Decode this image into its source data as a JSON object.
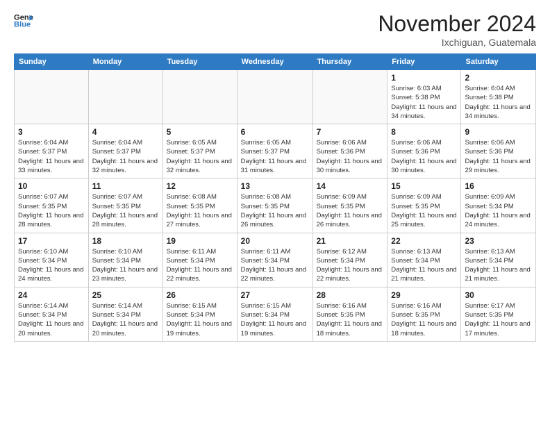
{
  "header": {
    "logo_line1": "General",
    "logo_line2": "Blue",
    "month_title": "November 2024",
    "location": "Ixchiguan, Guatemala"
  },
  "weekdays": [
    "Sunday",
    "Monday",
    "Tuesday",
    "Wednesday",
    "Thursday",
    "Friday",
    "Saturday"
  ],
  "weeks": [
    [
      {
        "day": "",
        "info": ""
      },
      {
        "day": "",
        "info": ""
      },
      {
        "day": "",
        "info": ""
      },
      {
        "day": "",
        "info": ""
      },
      {
        "day": "",
        "info": ""
      },
      {
        "day": "1",
        "info": "Sunrise: 6:03 AM\nSunset: 5:38 PM\nDaylight: 11 hours\nand 34 minutes."
      },
      {
        "day": "2",
        "info": "Sunrise: 6:04 AM\nSunset: 5:38 PM\nDaylight: 11 hours\nand 34 minutes."
      }
    ],
    [
      {
        "day": "3",
        "info": "Sunrise: 6:04 AM\nSunset: 5:37 PM\nDaylight: 11 hours\nand 33 minutes."
      },
      {
        "day": "4",
        "info": "Sunrise: 6:04 AM\nSunset: 5:37 PM\nDaylight: 11 hours\nand 32 minutes."
      },
      {
        "day": "5",
        "info": "Sunrise: 6:05 AM\nSunset: 5:37 PM\nDaylight: 11 hours\nand 32 minutes."
      },
      {
        "day": "6",
        "info": "Sunrise: 6:05 AM\nSunset: 5:37 PM\nDaylight: 11 hours\nand 31 minutes."
      },
      {
        "day": "7",
        "info": "Sunrise: 6:06 AM\nSunset: 5:36 PM\nDaylight: 11 hours\nand 30 minutes."
      },
      {
        "day": "8",
        "info": "Sunrise: 6:06 AM\nSunset: 5:36 PM\nDaylight: 11 hours\nand 30 minutes."
      },
      {
        "day": "9",
        "info": "Sunrise: 6:06 AM\nSunset: 5:36 PM\nDaylight: 11 hours\nand 29 minutes."
      }
    ],
    [
      {
        "day": "10",
        "info": "Sunrise: 6:07 AM\nSunset: 5:35 PM\nDaylight: 11 hours\nand 28 minutes."
      },
      {
        "day": "11",
        "info": "Sunrise: 6:07 AM\nSunset: 5:35 PM\nDaylight: 11 hours\nand 28 minutes."
      },
      {
        "day": "12",
        "info": "Sunrise: 6:08 AM\nSunset: 5:35 PM\nDaylight: 11 hours\nand 27 minutes."
      },
      {
        "day": "13",
        "info": "Sunrise: 6:08 AM\nSunset: 5:35 PM\nDaylight: 11 hours\nand 26 minutes."
      },
      {
        "day": "14",
        "info": "Sunrise: 6:09 AM\nSunset: 5:35 PM\nDaylight: 11 hours\nand 26 minutes."
      },
      {
        "day": "15",
        "info": "Sunrise: 6:09 AM\nSunset: 5:35 PM\nDaylight: 11 hours\nand 25 minutes."
      },
      {
        "day": "16",
        "info": "Sunrise: 6:09 AM\nSunset: 5:34 PM\nDaylight: 11 hours\nand 24 minutes."
      }
    ],
    [
      {
        "day": "17",
        "info": "Sunrise: 6:10 AM\nSunset: 5:34 PM\nDaylight: 11 hours\nand 24 minutes."
      },
      {
        "day": "18",
        "info": "Sunrise: 6:10 AM\nSunset: 5:34 PM\nDaylight: 11 hours\nand 23 minutes."
      },
      {
        "day": "19",
        "info": "Sunrise: 6:11 AM\nSunset: 5:34 PM\nDaylight: 11 hours\nand 22 minutes."
      },
      {
        "day": "20",
        "info": "Sunrise: 6:11 AM\nSunset: 5:34 PM\nDaylight: 11 hours\nand 22 minutes."
      },
      {
        "day": "21",
        "info": "Sunrise: 6:12 AM\nSunset: 5:34 PM\nDaylight: 11 hours\nand 22 minutes."
      },
      {
        "day": "22",
        "info": "Sunrise: 6:13 AM\nSunset: 5:34 PM\nDaylight: 11 hours\nand 21 minutes."
      },
      {
        "day": "23",
        "info": "Sunrise: 6:13 AM\nSunset: 5:34 PM\nDaylight: 11 hours\nand 21 minutes."
      }
    ],
    [
      {
        "day": "24",
        "info": "Sunrise: 6:14 AM\nSunset: 5:34 PM\nDaylight: 11 hours\nand 20 minutes."
      },
      {
        "day": "25",
        "info": "Sunrise: 6:14 AM\nSunset: 5:34 PM\nDaylight: 11 hours\nand 20 minutes."
      },
      {
        "day": "26",
        "info": "Sunrise: 6:15 AM\nSunset: 5:34 PM\nDaylight: 11 hours\nand 19 minutes."
      },
      {
        "day": "27",
        "info": "Sunrise: 6:15 AM\nSunset: 5:34 PM\nDaylight: 11 hours\nand 19 minutes."
      },
      {
        "day": "28",
        "info": "Sunrise: 6:16 AM\nSunset: 5:35 PM\nDaylight: 11 hours\nand 18 minutes."
      },
      {
        "day": "29",
        "info": "Sunrise: 6:16 AM\nSunset: 5:35 PM\nDaylight: 11 hours\nand 18 minutes."
      },
      {
        "day": "30",
        "info": "Sunrise: 6:17 AM\nSunset: 5:35 PM\nDaylight: 11 hours\nand 17 minutes."
      }
    ]
  ]
}
